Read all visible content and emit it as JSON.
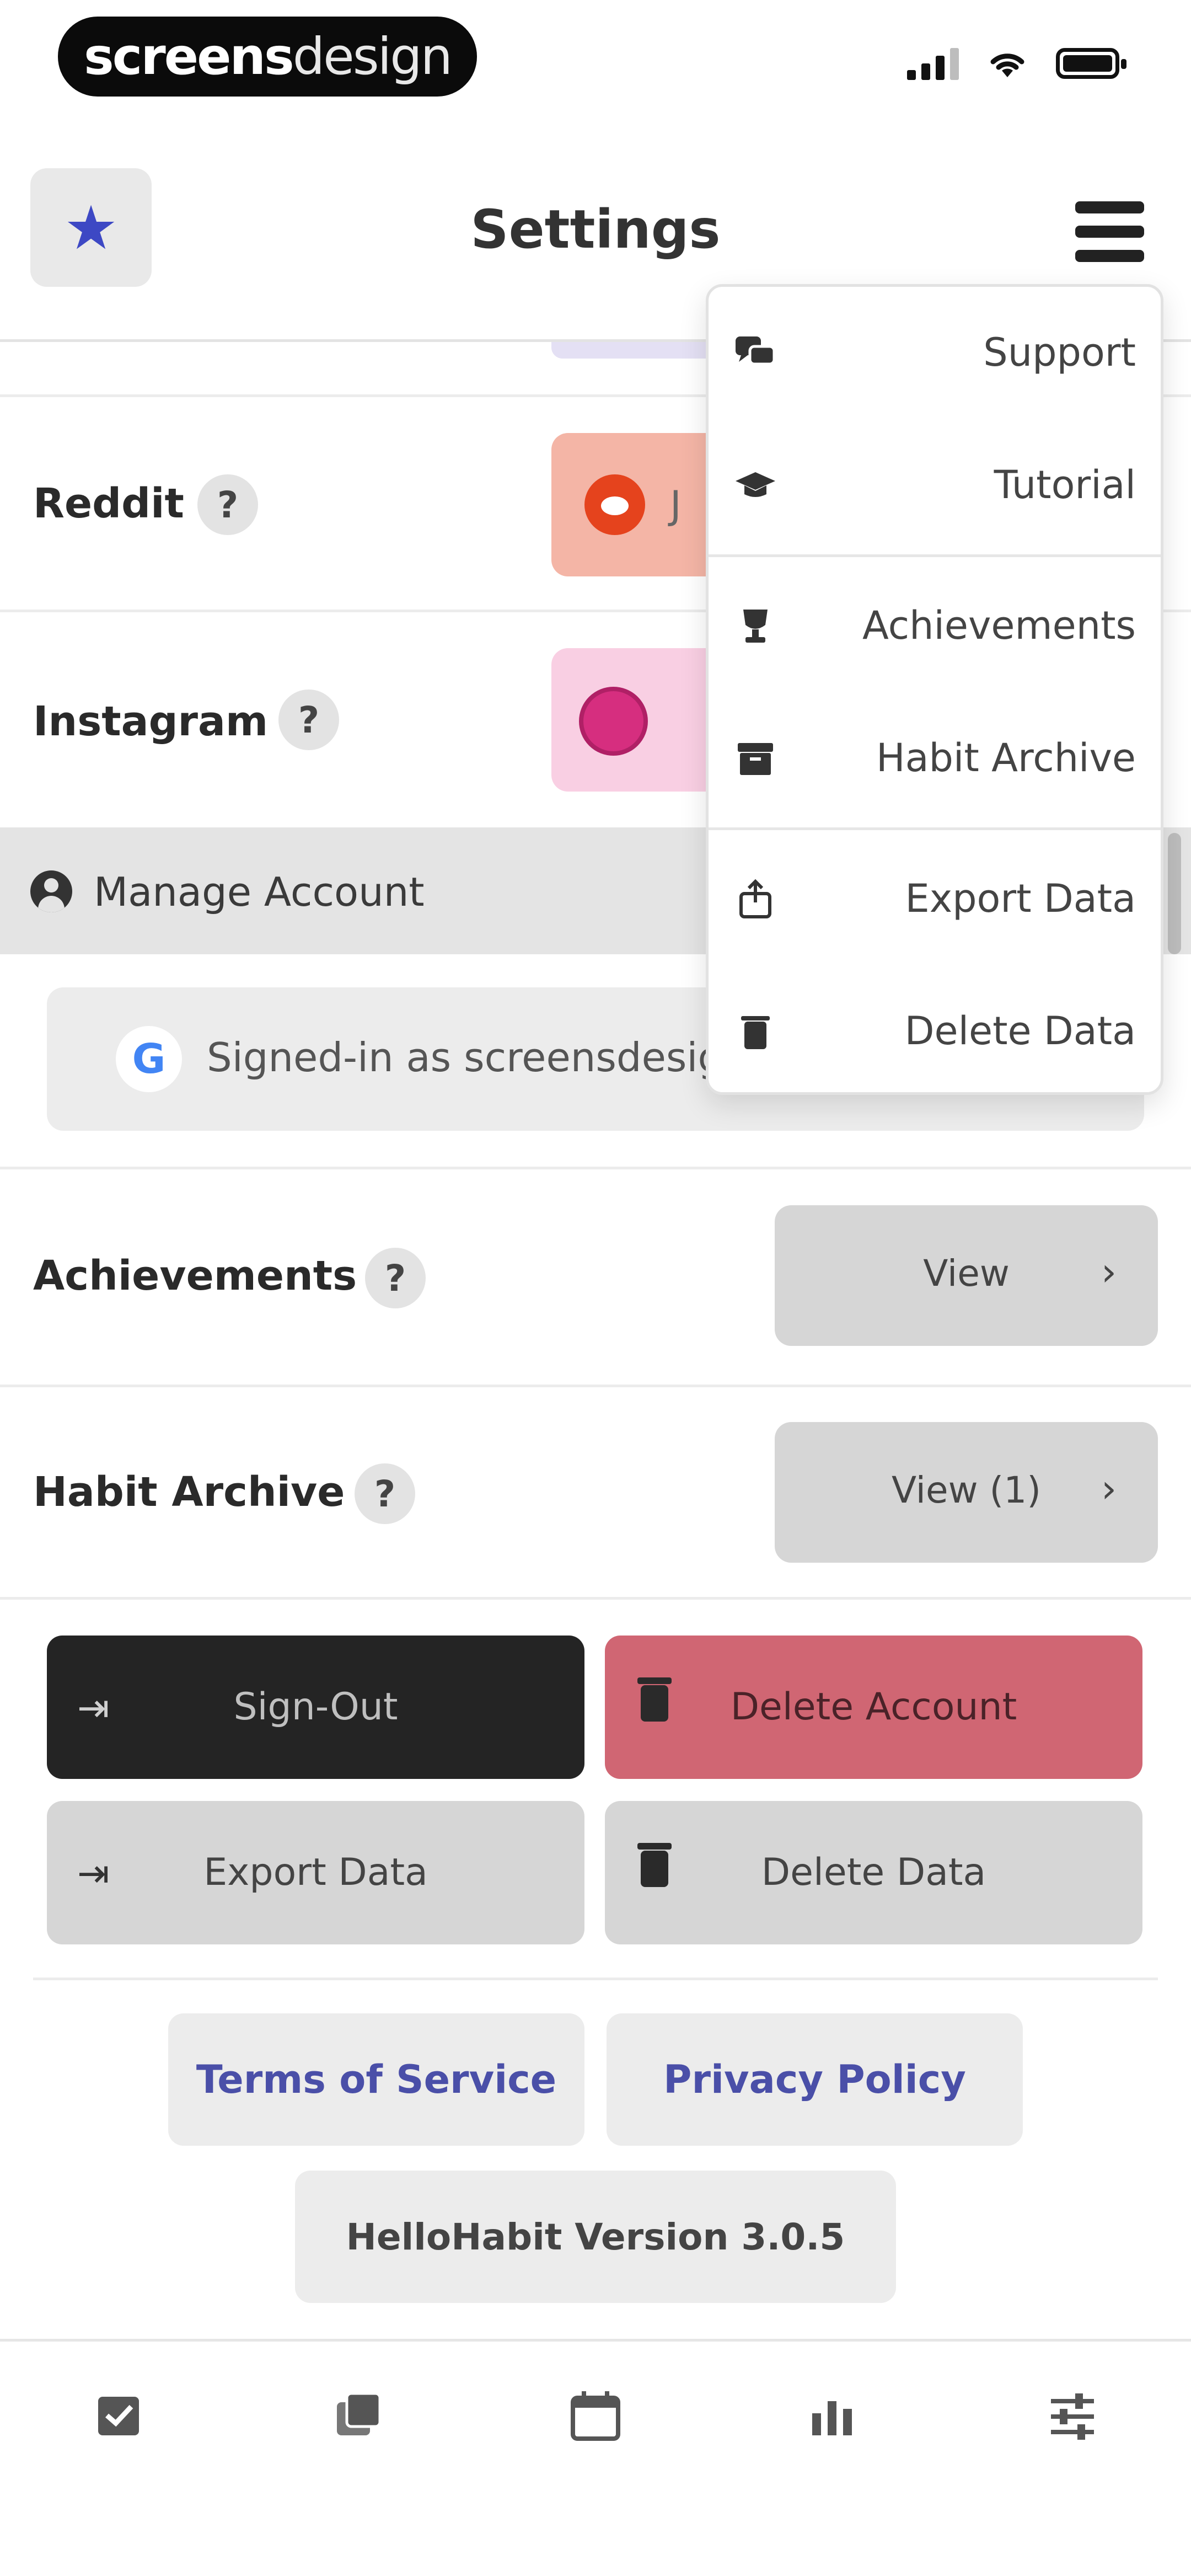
{
  "status_bar": {
    "brand_bold": "screens",
    "brand_light": "design",
    "icons": [
      "signal-icon",
      "wifi-icon",
      "battery-icon"
    ]
  },
  "header": {
    "title": "Settings",
    "star_icon": "star-icon",
    "menu_icon": "hamburger-icon",
    "accent": "#3d48c4"
  },
  "social": {
    "reddit": {
      "label": "Reddit",
      "help": "?",
      "button_peek": "J",
      "color": "#f4b5a6"
    },
    "instagram": {
      "label": "Instagram",
      "help": "?",
      "color": "#f9cfe3"
    }
  },
  "account": {
    "section_label": "Manage Account",
    "signed_in_text": "Signed-in as screensdesign",
    "google_glyph": "G"
  },
  "achievements": {
    "label": "Achievements",
    "help": "?",
    "button": "View",
    "chevron": "›"
  },
  "habit_archive": {
    "label": "Habit Archive",
    "help": "?",
    "button": "View (1)",
    "chevron": "›"
  },
  "actions": {
    "sign_out": "Sign-Out",
    "delete_account": "Delete Account",
    "export_data": "Export Data",
    "delete_data": "Delete Data",
    "danger_color": "#d06673",
    "dark_color": "#242424"
  },
  "links": {
    "terms": "Terms of Service",
    "privacy": "Privacy Policy",
    "version": "HelloHabit Version 3.0.5",
    "link_color": "#4a4fa8"
  },
  "tabbar": {
    "tabs": [
      "checkbox-icon",
      "habits-icon",
      "calendar-icon",
      "stats-icon",
      "settings-sliders-icon"
    ]
  },
  "dropdown": {
    "items": [
      {
        "label": "Support",
        "icon": "chat-icon"
      },
      {
        "label": "Tutorial",
        "icon": "graduation-cap-icon"
      },
      {
        "label": "Achievements",
        "icon": "trophy-icon"
      },
      {
        "label": "Habit Archive",
        "icon": "archive-box-icon"
      },
      {
        "label": "Export Data",
        "icon": "export-icon"
      },
      {
        "label": "Delete Data",
        "icon": "trash-icon"
      }
    ]
  }
}
